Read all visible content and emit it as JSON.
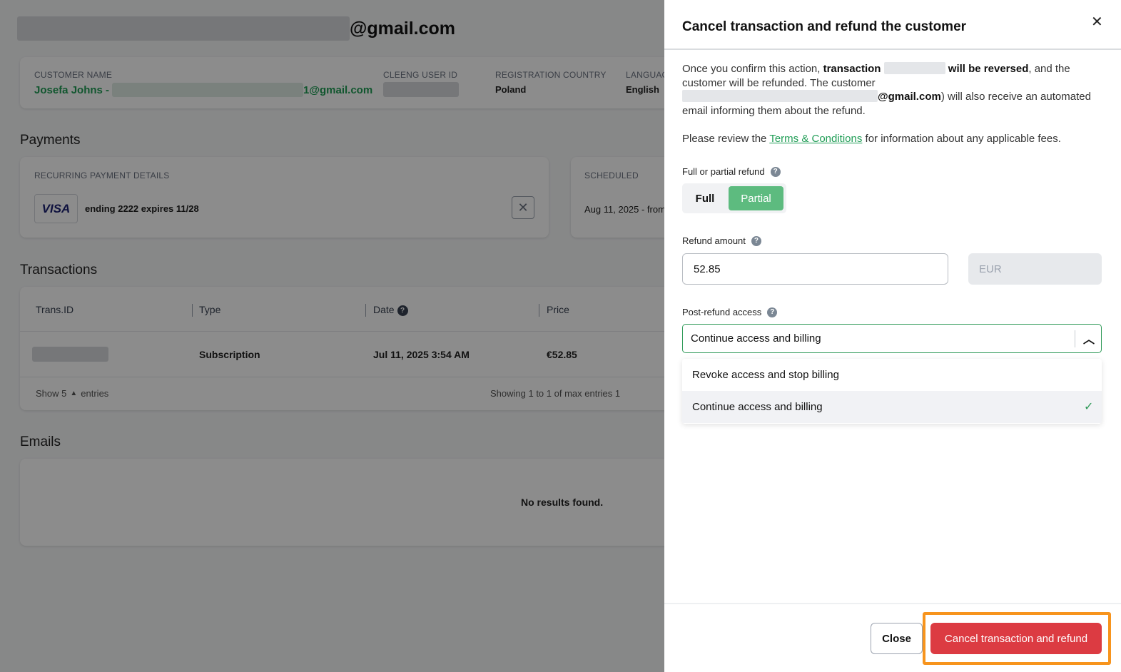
{
  "page": {
    "title_email_suffix": "@gmail.com"
  },
  "customer_card": {
    "name_label": "CUSTOMER NAME",
    "name_value": "Josefa Johns -",
    "email_suffix": "1@gmail.com",
    "user_id_label": "CLEENG USER ID",
    "country_label": "REGISTRATION COUNTRY",
    "country_value": "Poland",
    "language_label": "LANGUAG",
    "language_value": "English"
  },
  "payments": {
    "section_title": "Payments",
    "recurring_label": "RECURRING PAYMENT DETAILS",
    "card_brand": "VISA",
    "card_text": "ending 2222 expires 11/28",
    "scheduled_label": "SCHEDULED",
    "scheduled_value": "Aug 11, 2025 - from"
  },
  "transactions": {
    "section_title": "Transactions",
    "columns": [
      "Trans.ID",
      "Type",
      "Date",
      "Price"
    ],
    "row": {
      "type": "Subscription",
      "date": "Jul 11, 2025 3:54 AM",
      "price": "€52.85"
    },
    "show_label": "Show 5",
    "entries_label": "entries",
    "showing_text": "Showing 1 to 1 of max entries 1"
  },
  "emails": {
    "section_title": "Emails",
    "empty_text": "No results found."
  },
  "drawer": {
    "title": "Cancel transaction and refund the customer",
    "intro_1": "Once you confirm this action,",
    "intro_bold_1": "transaction",
    "intro_bold_2": "will be reversed",
    "intro_2": ", and the customer will be refunded. The customer",
    "intro_email_suffix": "@gmail.com",
    "intro_3": ") will also receive an automated email informing them about the refund.",
    "review_pre": "Please review the",
    "review_link": "Terms & Conditions",
    "review_post": "for information about any applicable fees.",
    "refund_type_label": "Full or partial refund",
    "refund_full": "Full",
    "refund_partial": "Partial",
    "refund_selected": "Partial",
    "amount_label": "Refund amount",
    "amount_value": "52.85",
    "currency_value": "EUR",
    "access_label": "Post-refund access",
    "access_selected": "Continue access and billing",
    "access_options": [
      "Revoke access and stop billing",
      "Continue access and billing"
    ],
    "close_button": "Close",
    "confirm_button": "Cancel transaction and refund",
    "accent_color": "#1f9d55",
    "danger_color": "#dc3b42",
    "highlight_color": "#f7941d"
  }
}
